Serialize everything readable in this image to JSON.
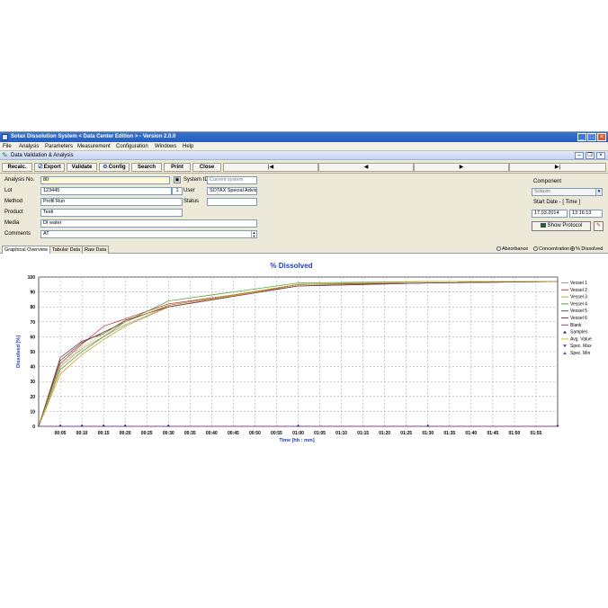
{
  "window": {
    "title": "Sotax Dissolution System < Data Center Edition > - Version 2.0.0"
  },
  "menu": [
    "File",
    "Analysis",
    "Parameters",
    "Measurement",
    "Configuration",
    "Windows",
    "Help"
  ],
  "subwindow": {
    "title": "Data Validation & Analysis"
  },
  "toolbar": {
    "recalc": "Recalc.",
    "export": "Export",
    "validate": "Validate",
    "config": "Config",
    "search": "Search",
    "print": "Print",
    "close": "Close",
    "first": "|◀",
    "prev": "◀",
    "next": "▶",
    "last": "▶|"
  },
  "form": {
    "analysis_no_label": "Analysis No.",
    "analysis_no": "80",
    "lot_label": "Lot",
    "lot": "123445",
    "lot_num": "1",
    "method_label": "Method",
    "method": "Profil Run",
    "product_label": "Product",
    "product": "Testi",
    "media_label": "Media",
    "media": "DI water",
    "comments_label": "Comments",
    "comments": "AT",
    "system_id_label": "System ID",
    "system_id": "Current system",
    "user_label": "User",
    "user": "SOTAX Special Advisor",
    "status_label": "Status",
    "status": "",
    "component_label": "Component",
    "component": "Sotaxin",
    "start_date_label": "Start Date - [ Time ]",
    "start_date": "17.03.2014",
    "start_time": "13:16:13",
    "show_protocol": "Show Protocol"
  },
  "tabs": [
    "Graphical Overview",
    "Tabular Data",
    "Raw Data"
  ],
  "radios": {
    "absorbance": "Absorbance",
    "concentration": "Concentration",
    "dissolved": "% Dissolved"
  },
  "colors": {
    "v1": "#a0a0a0",
    "v2": "#c04040",
    "v3": "#d0a020",
    "v4": "#60a040",
    "v5": "#505050",
    "v6": "#7a3a4a",
    "blank": "#8040a0",
    "samples": "#303060",
    "avg": "#e0c020",
    "specmax": "#3050c0",
    "specmin": "#7050c0"
  },
  "chart_data": {
    "type": "line",
    "title": "% Dissolved",
    "xlabel": "Time [hh : mm]",
    "ylabel": "Dissolved [%]",
    "ylim": [
      0,
      100
    ],
    "yticks": [
      0,
      10,
      20,
      30,
      40,
      50,
      60,
      70,
      80,
      90,
      100
    ],
    "xticks": [
      "00:05",
      "00:10",
      "00:15",
      "00:20",
      "00:25",
      "00:30",
      "00:35",
      "00:40",
      "00:45",
      "00:50",
      "00:55",
      "01:00",
      "01:05",
      "01:10",
      "01:15",
      "01:20",
      "01:25",
      "01:30",
      "01:35",
      "01:40",
      "01:45",
      "01:50",
      "01:55"
    ],
    "x_minutes": [
      0,
      5,
      10,
      15,
      20,
      30,
      60,
      90,
      120
    ],
    "xmax_minutes": 120,
    "legend_position": "right",
    "grid": true,
    "series": [
      {
        "name": "Vessel 1",
        "values": [
          0,
          40,
          52,
          60,
          68,
          80,
          95,
          97,
          97
        ]
      },
      {
        "name": "Vessel 2",
        "values": [
          0,
          42,
          55,
          67,
          72,
          82,
          94,
          96,
          97
        ]
      },
      {
        "name": "Vessel 3",
        "values": [
          0,
          35,
          48,
          58,
          67,
          80,
          95,
          97,
          97
        ]
      },
      {
        "name": "Vessel 4",
        "values": [
          0,
          38,
          50,
          60,
          70,
          84,
          96,
          97,
          97
        ]
      },
      {
        "name": "Vessel 5",
        "values": [
          0,
          44,
          56,
          63,
          70,
          81,
          95,
          96,
          97
        ]
      },
      {
        "name": "Vessel 6",
        "values": [
          0,
          46,
          57,
          62,
          71,
          80,
          94,
          96,
          97
        ]
      },
      {
        "name": "Blank",
        "values": [
          0,
          0,
          0,
          0,
          0,
          0,
          0,
          0,
          0
        ]
      },
      {
        "name": "Samples",
        "values": [
          0,
          0,
          0,
          0,
          0,
          0,
          0,
          0,
          0
        ]
      },
      {
        "name": "Avg. Value",
        "values": [
          0,
          41,
          53,
          62,
          70,
          81,
          95,
          97,
          97
        ]
      },
      {
        "name": "Spec. Max",
        "values": []
      },
      {
        "name": "Spec. Min",
        "values": []
      }
    ]
  }
}
